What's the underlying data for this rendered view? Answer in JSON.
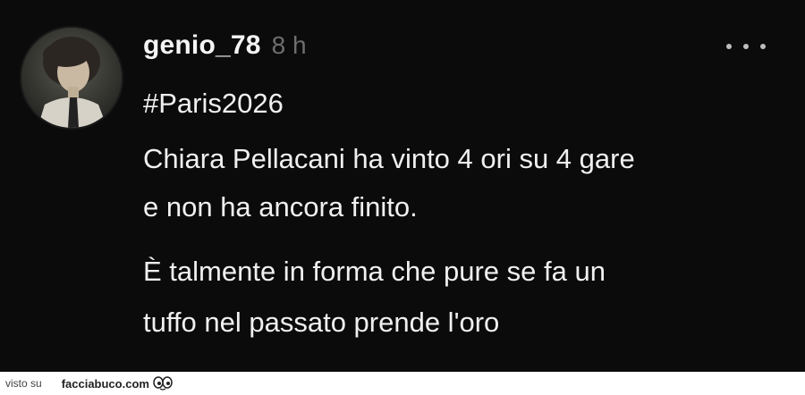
{
  "post": {
    "username": "genio_78",
    "time": "8 h",
    "lines": [
      "#Paris2026",
      "Chiara Pellacani ha vinto 4 ori su 4 gare",
      "e non ha ancora finito.",
      "È talmente in forma che pure se fa un",
      "tuffo nel passato prende l'oro"
    ],
    "more_icon": "more-horizontal-icon"
  },
  "footer": {
    "visto_su": "visto su",
    "brand": "facciabuco.com"
  },
  "colors": {
    "background": "#0b0b0b",
    "text": "#f0f0f0",
    "muted": "#6e6e6e",
    "footer_bg": "#ffffff"
  }
}
